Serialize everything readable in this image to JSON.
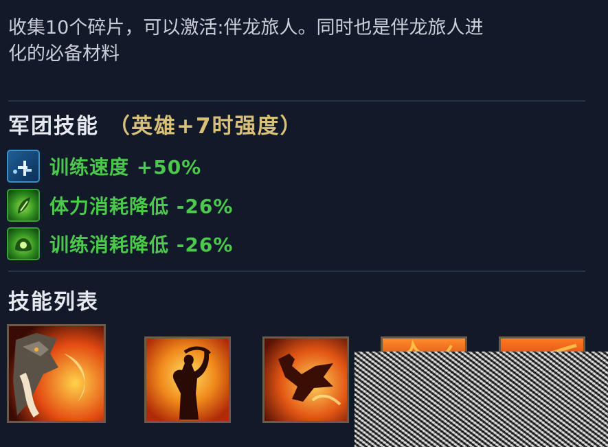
{
  "description": {
    "line1": "收集10个碎片，可以激活:伴龙旅人。同时也是伴龙旅人进",
    "line2": "化的必备材料"
  },
  "legion": {
    "title": "军团技能",
    "hint": "（英雄+7时强度）",
    "effects": [
      {
        "icon": "training-speed-icon",
        "label": "训练速度 +50%"
      },
      {
        "icon": "stamina-reduction-icon",
        "label": "体力消耗降低 -26%"
      },
      {
        "icon": "training-cost-reduction-icon",
        "label": "训练消耗降低 -26%"
      }
    ]
  },
  "skills": {
    "title": "技能列表",
    "items": [
      {
        "icon": "dragon-portrait-icon"
      },
      {
        "icon": "flame-figure-icon"
      },
      {
        "icon": "flying-dragon-icon"
      },
      {
        "icon": "fire-skill-icon"
      },
      {
        "icon": "fire-skill-icon"
      }
    ]
  },
  "colors": {
    "background": "#121a29",
    "effect_text": "#4cc94d",
    "hint_text": "#d9c07a",
    "body_text": "#c9ced8"
  }
}
